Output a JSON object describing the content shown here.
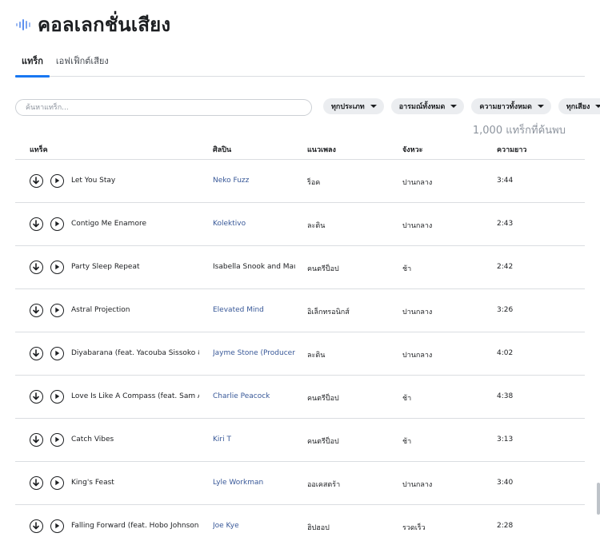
{
  "header": {
    "title": "คอลเลกชั่นเสียง",
    "icon": "sound-wave-icon",
    "accent": "#1877f2"
  },
  "tabs": [
    {
      "label": "แทร็ก",
      "active": true
    },
    {
      "label": "เอฟเฟ็กต์เสียง",
      "active": false
    }
  ],
  "search": {
    "placeholder": "ค้นหาแทร็ก..."
  },
  "filters": [
    {
      "label": "ทุกประเภท"
    },
    {
      "label": "อารมณ์ทั้งหมด"
    },
    {
      "label": "ความยาวทั้งหมด"
    },
    {
      "label": "ทุกเสียง"
    }
  ],
  "count_text": "1,000 แทร็กที่ค้นพบ",
  "columns": {
    "track": "แทร็ค",
    "artist": "ศิลปิน",
    "genre": "แนวเพลง",
    "tempo": "จังหวะ",
    "duration": "ความยาว"
  },
  "rows": [
    {
      "track": "Let You Stay",
      "artist": "Neko Fuzz",
      "artist_link": true,
      "genre": "ร็อค",
      "tempo": "ปานกลาง",
      "duration": "3:44"
    },
    {
      "track": "Contigo Me Enamore",
      "artist": "Kolektivo",
      "artist_link": true,
      "genre": "ละติน",
      "tempo": "ปานกลาง",
      "duration": "2:43"
    },
    {
      "track": "Party Sleep Repeat",
      "artist": "Isabella Snook and Maui",
      "artist_link": false,
      "genre": "คนตรีป็อป",
      "tempo": "ช้า",
      "duration": "2:42"
    },
    {
      "track": "Astral Projection",
      "artist": "Elevated Mind",
      "artist_link": true,
      "genre": "อิเล็กทรอนิกส์",
      "tempo": "ปานกลาง",
      "duration": "3:26"
    },
    {
      "track": "Diyabarana (feat. Yacouba Sissoko & Ka",
      "artist": "Jayme Stone (Producer)",
      "artist_link": true,
      "genre": "ละติน",
      "tempo": "ปานกลาง",
      "duration": "4:02"
    },
    {
      "track": "Love Is Like A Compass (feat. Sam Ashv",
      "artist": "Charlie Peacock",
      "artist_link": true,
      "genre": "คนตรีป็อป",
      "tempo": "ช้า",
      "duration": "4:38"
    },
    {
      "track": "Catch Vibes",
      "artist": "Kiri T",
      "artist_link": true,
      "genre": "คนตรีป็อป",
      "tempo": "ช้า",
      "duration": "3:13"
    },
    {
      "track": "King's Feast",
      "artist": "Lyle Workman",
      "artist_link": true,
      "genre": "ออเคสตร้า",
      "tempo": "ปานกลาง",
      "duration": "3:40"
    },
    {
      "track": "Falling Forward (feat. Hobo Johnson)",
      "artist": "Joe Kye",
      "artist_link": true,
      "genre": "ฮิปฮอป",
      "tempo": "รวดเร็ว",
      "duration": "2:28"
    }
  ]
}
